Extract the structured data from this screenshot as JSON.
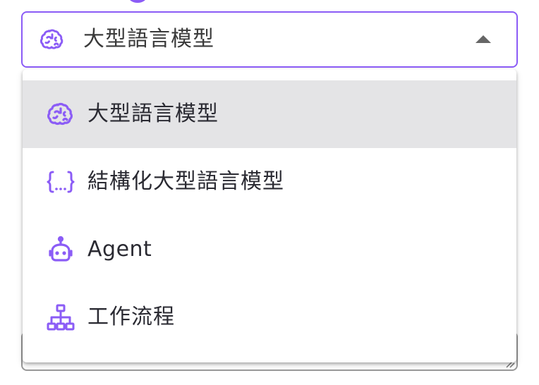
{
  "select": {
    "current_value": "大型語言模型",
    "current_icon": "brain-icon",
    "expanded": true
  },
  "menu": {
    "items": [
      {
        "label": "大型語言模型",
        "icon": "brain-icon",
        "selected": true
      },
      {
        "label": "結構化大型語言模型",
        "icon": "curly-braces-icon",
        "selected": false
      },
      {
        "label": "Agent",
        "icon": "robot-icon",
        "selected": false
      },
      {
        "label": "工作流程",
        "icon": "sitemap-icon",
        "selected": false
      }
    ]
  },
  "colors": {
    "accent": "#8b5cf6",
    "selected_background": "#e4e4e6",
    "text": "#2a2a32",
    "caret": "#666666"
  }
}
